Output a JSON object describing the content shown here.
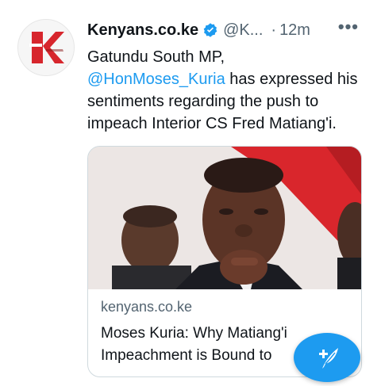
{
  "tweet": {
    "author_name": "Kenyans.co.ke",
    "handle": "@K...",
    "separator": "·",
    "time": "12m",
    "more_label": "•••",
    "text_line1": "Gatundu South MP,",
    "mention": "@HonMoses_Kuria",
    "text_rest": " has expressed his sentiments regarding the push to impeach Interior CS Fred Matiang'i."
  },
  "link_card": {
    "domain": "kenyans.co.ke",
    "title_line1": "Moses Kuria: Why Matiang'i",
    "title_line2": "Impeachment is Bound to"
  },
  "colors": {
    "accent": "#1d9bf0",
    "logo_red": "#d7262d",
    "text": "#0f1419",
    "muted": "#536471"
  },
  "icons": {
    "verified": "verified-badge-icon",
    "more": "more-icon",
    "compose": "compose-tweet-icon",
    "logo": "kenyans-logo-icon"
  }
}
